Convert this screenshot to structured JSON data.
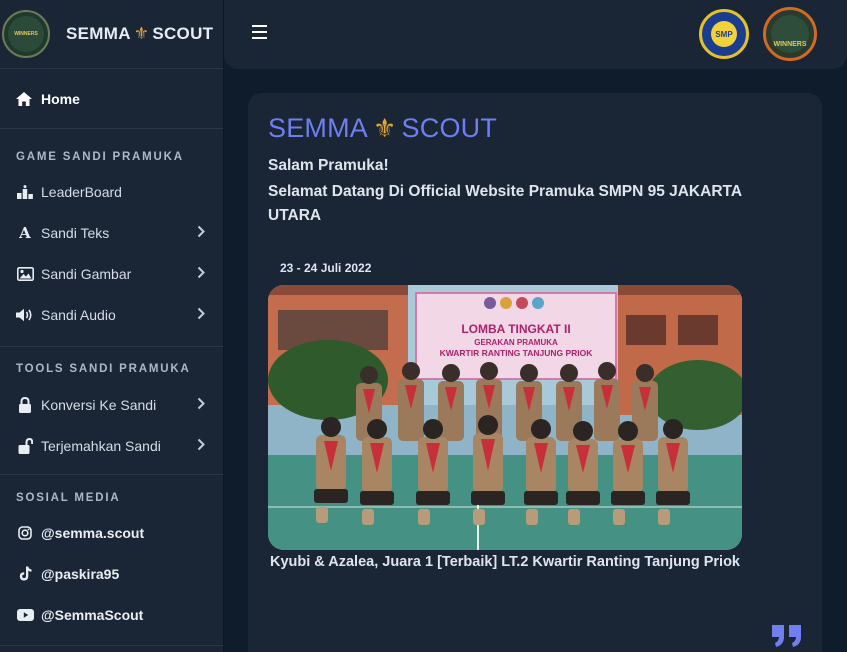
{
  "sidebar": {
    "brand": {
      "prefix": "SEMMA",
      "fleur": "⚜",
      "suffix": "SCOUT",
      "logo_text": "WINNERS"
    },
    "home_label": "Home",
    "sections": {
      "game": "GAME SANDI PRAMUKA",
      "tools": "TOOLS SANDI PRAMUKA",
      "social": "SOSIAL MEDIA"
    },
    "game_items": [
      "LeaderBoard",
      "Sandi Teks",
      "Sandi Gambar",
      "Sandi Audio"
    ],
    "tool_items": [
      "Konversi Ke Sandi",
      "Terjemahkan Sandi"
    ],
    "social_items": [
      "@semma.scout",
      "@paskira95",
      "@SemmaScout"
    ]
  },
  "topbar": {
    "logo_a_text": "SMP",
    "logo_b_text": "WINNERS"
  },
  "main": {
    "brand": {
      "prefix": "SEMMA",
      "fleur": "⚜",
      "suffix": "SCOUT"
    },
    "greeting": "Salam Pramuka!",
    "welcome": "Selamat Datang Di Official Website Pramuka SMPN 95 JAKARTA UTARA",
    "event_date": "23 - 24 Juli 2022",
    "banner": {
      "title": "LOMBA TINGKAT II",
      "subtitle1": "GERAKAN PRAMUKA",
      "subtitle2": "KWARTIR RANTING TANJUNG PRIOK"
    },
    "caption": "Kyubi & Azalea, Juara 1 [Terbaik] LT.2 Kwartir Ranting Tanjung Priok"
  },
  "colors": {
    "background": "#0f1c2c",
    "panel": "#1a2535",
    "accent": "#6f7ff0",
    "fleur": "#e0a73a"
  }
}
